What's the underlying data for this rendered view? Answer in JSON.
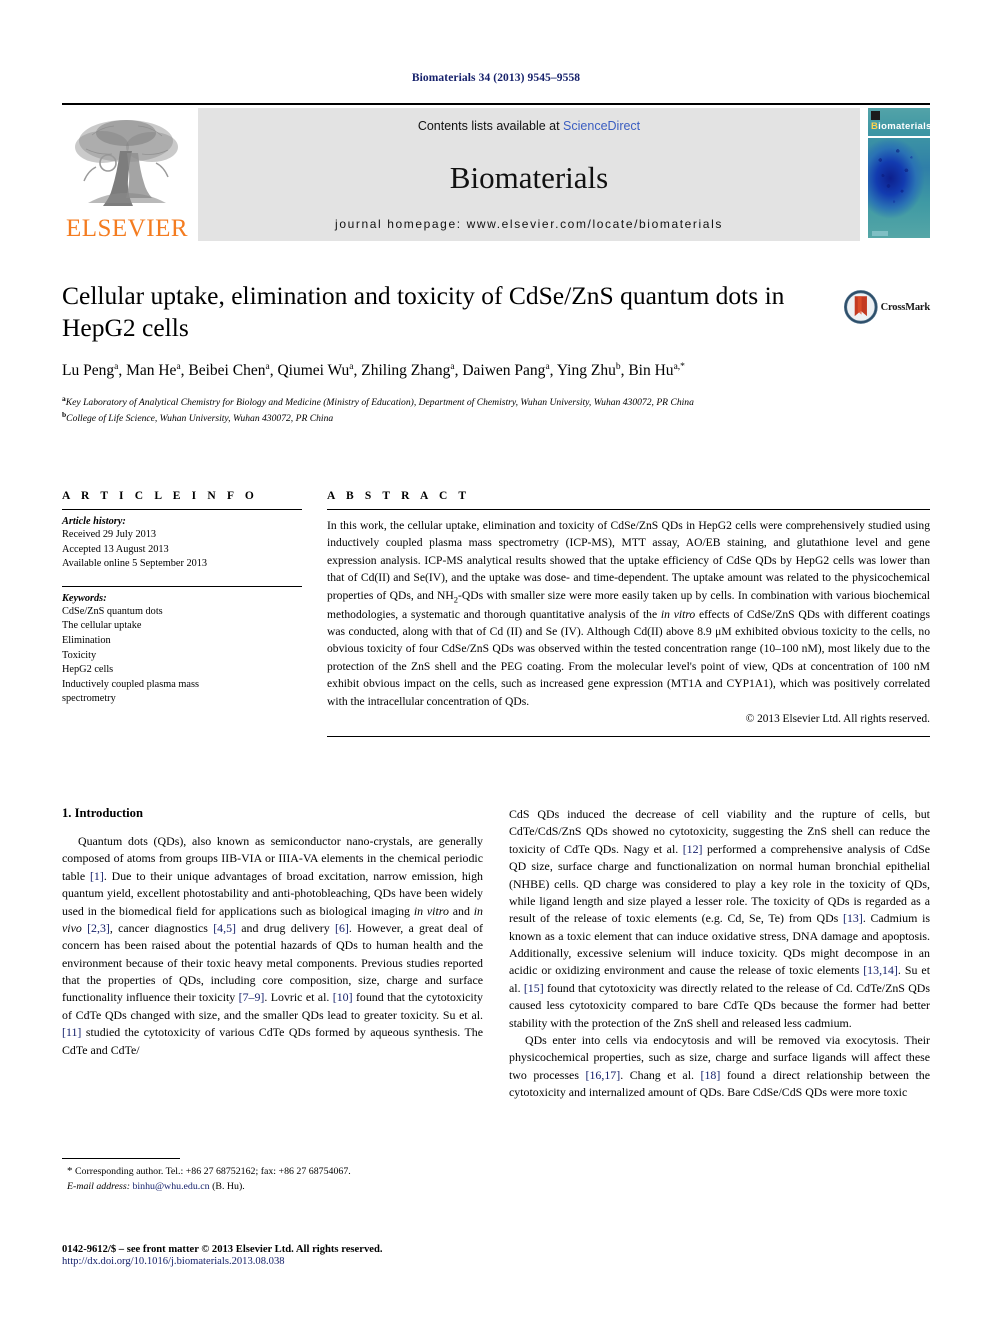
{
  "running_head": "Biomaterials 34 (2013) 9545–9558",
  "masthead": {
    "contents_prefix": "Contents lists available at ",
    "sciencedirect": "ScienceDirect",
    "journal_title": "Biomaterials",
    "homepage": "journal homepage: www.elsevier.com/locate/biomaterials",
    "publisher_wordmark": "ELSEVIER",
    "cover_brand_b": "B",
    "cover_brand_rest": "iomaterials",
    "cover_footer": "ELSEVIER",
    "link_color": "#3b5ec1",
    "band_color": "#e3e3e3",
    "elsevier_orange": "#f47c20"
  },
  "title_block": {
    "title": "Cellular uptake, elimination and toxicity of CdSe/ZnS quantum dots in HepG2 cells",
    "crossmark_label": "CrossMark",
    "authors": [
      {
        "name": "Lu Peng",
        "sup": "a",
        "sep": ", "
      },
      {
        "name": "Man He",
        "sup": "a",
        "sep": ", "
      },
      {
        "name": "Beibei Chen",
        "sup": "a",
        "sep": ", "
      },
      {
        "name": "Qiumei Wu",
        "sup": "a",
        "sep": ", "
      },
      {
        "name": "Zhiling Zhang",
        "sup": "a",
        "sep": ", "
      },
      {
        "name": "Daiwen Pang",
        "sup": "a",
        "sep": ", "
      },
      {
        "name": "Ying Zhu",
        "sup": "b",
        "sep": ", "
      },
      {
        "name": "Bin Hu",
        "sup": "a,*",
        "sep": ""
      }
    ],
    "affiliations": [
      {
        "sup": "a",
        "text": "Key Laboratory of Analytical Chemistry for Biology and Medicine (Ministry of Education), Department of Chemistry, Wuhan University, Wuhan 430072, PR China"
      },
      {
        "sup": "b",
        "text": "College of Life Science, Wuhan University, Wuhan 430072, PR China"
      }
    ]
  },
  "article_info": {
    "heading": "A R T I C L E  I N F O",
    "history_label": "Article history:",
    "history": [
      "Received 29 July 2013",
      "Accepted 13 August 2013",
      "Available online 5 September 2013"
    ],
    "keywords_label": "Keywords:",
    "keywords": [
      "CdSe/ZnS quantum dots",
      "The cellular uptake",
      "Elimination",
      "Toxicity",
      "HepG2 cells",
      "Inductively coupled plasma mass",
      "spectrometry"
    ]
  },
  "abstract": {
    "heading": "A B S T R A C T",
    "part1": "In this work, the cellular uptake, elimination and toxicity of CdSe/ZnS QDs in HepG2 cells were comprehensively studied using inductively coupled plasma mass spectrometry (ICP-MS), MTT assay, AO/EB staining, and glutathione level and gene expression analysis. ICP-MS analytical results showed that the uptake efficiency of CdSe QDs by HepG2 cells was lower than that of Cd(II) and Se(IV), and the uptake was dose- and time-dependent. The uptake amount was related to the physicochemical properties of QDs, and NH",
    "sub1": "2",
    "part2": "-QDs with smaller size were more easily taken up by cells. In combination with various biochemical methodologies, a systematic and thorough quantitative analysis of the ",
    "italic1": "in vitro",
    "part3": " effects of CdSe/ZnS QDs with different coatings was conducted, along with that of Cd (II) and Se (IV). Although Cd(II) above 8.9 μM exhibited obvious toxicity to the cells, no obvious toxicity of four CdSe/ZnS QDs was observed within the tested concentration range (10–100 nM), most likely due to the protection of the ZnS shell and the PEG coating. From the molecular level's point of view, QDs at concentration of 100 nM exhibit obvious impact on the cells, such as increased gene expression (MT1A and CYP1A1), which was positively correlated with the intracellular concentration of QDs.",
    "copyright": "© 2013 Elsevier Ltd. All rights reserved."
  },
  "body": {
    "section_number_title": "1. Introduction",
    "left_para1_a": "Quantum dots (QDs), also known as semiconductor nano-crystals, are generally composed of atoms from groups IIB-VIA or IIIA-VA elements in the chemical periodic table ",
    "left_ref1": "[1]",
    "left_para1_b": ". Due to their unique advantages of broad excitation, narrow emission, high quantum yield, excellent photostability and anti-photobleaching, QDs have been widely used in the biomedical field for applications such as biological imaging ",
    "left_italic1": "in vitro",
    "left_para1_c": " and ",
    "left_italic2": "in vivo",
    "left_para1_d": " ",
    "left_ref2": "[2,3]",
    "left_para1_e": ", cancer diagnostics ",
    "left_ref3": "[4,5]",
    "left_para1_f": " and drug delivery ",
    "left_ref4": "[6]",
    "left_para1_g": ". However, a great deal of concern has been raised about the potential hazards of QDs to human health and the environment because of their toxic heavy metal components. Previous studies reported that the properties of QDs, including core composition, size, charge and surface functionality influence their toxicity ",
    "left_ref5": "[7–9]",
    "left_para1_h": ". Lovric et al. ",
    "left_ref6": "[10]",
    "left_para1_i": " found that the cytotoxicity of CdTe QDs changed with size, and the smaller QDs lead to greater toxicity. Su et al. ",
    "left_ref7": "[11]",
    "left_para1_j": " studied the cytotoxicity of various CdTe QDs formed by aqueous synthesis. The CdTe and CdTe/",
    "right_para1_a": "CdS QDs induced the decrease of cell viability and the rupture of cells, but CdTe/CdS/ZnS QDs showed no cytotoxicity, suggesting the ZnS shell can reduce the toxicity of CdTe QDs. Nagy et al. ",
    "right_ref1": "[12]",
    "right_para1_b": " performed a comprehensive analysis of CdSe QD size, surface charge and functionalization on normal human bronchial epithelial (NHBE) cells. QD charge was considered to play a key role in the toxicity of QDs, while ligand length and size played a lesser role. The toxicity of QDs is regarded as a result of the release of toxic elements (e.g. Cd, Se, Te) from QDs ",
    "right_ref2": "[13]",
    "right_para1_c": ". Cadmium is known as a toxic element that can induce oxidative stress, DNA damage and apoptosis. Additionally, excessive selenium will induce toxicity. QDs might decompose in an acidic or oxidizing environment and cause the release of toxic elements ",
    "right_ref3": "[13,14]",
    "right_para1_d": ". Su et al. ",
    "right_ref4": "[15]",
    "right_para1_e": " found that cytotoxicity was directly related to the release of Cd. CdTe/ZnS QDs caused less cytotoxicity compared to bare CdTe QDs because the former had better stability with the protection of the ZnS shell and released less cadmium.",
    "right_para2_a": "QDs enter into cells via endocytosis and will be removed via exocytosis. Their physicochemical properties, such as size, charge and surface ligands will affect these two processes ",
    "right_ref5": "[16,17]",
    "right_para2_b": ". Chang et al. ",
    "right_ref6": "[18]",
    "right_para2_c": " found a direct relationship between the cytotoxicity and internalized amount of QDs. Bare CdSe/CdS QDs were more toxic"
  },
  "footnote": {
    "star": "*",
    "corresponding": " Corresponding author. Tel.: +86 27 68752162; fax: +86 27 68754067.",
    "email_label": "E-mail address:",
    "email": "binhu@whu.edu.cn",
    "email_suffix": " (B. Hu)."
  },
  "footer": {
    "issn_line": "0142-9612/$ – see front matter © 2013 Elsevier Ltd. All rights reserved.",
    "doi": "http://dx.doi.org/10.1016/j.biomaterials.2013.08.038"
  }
}
